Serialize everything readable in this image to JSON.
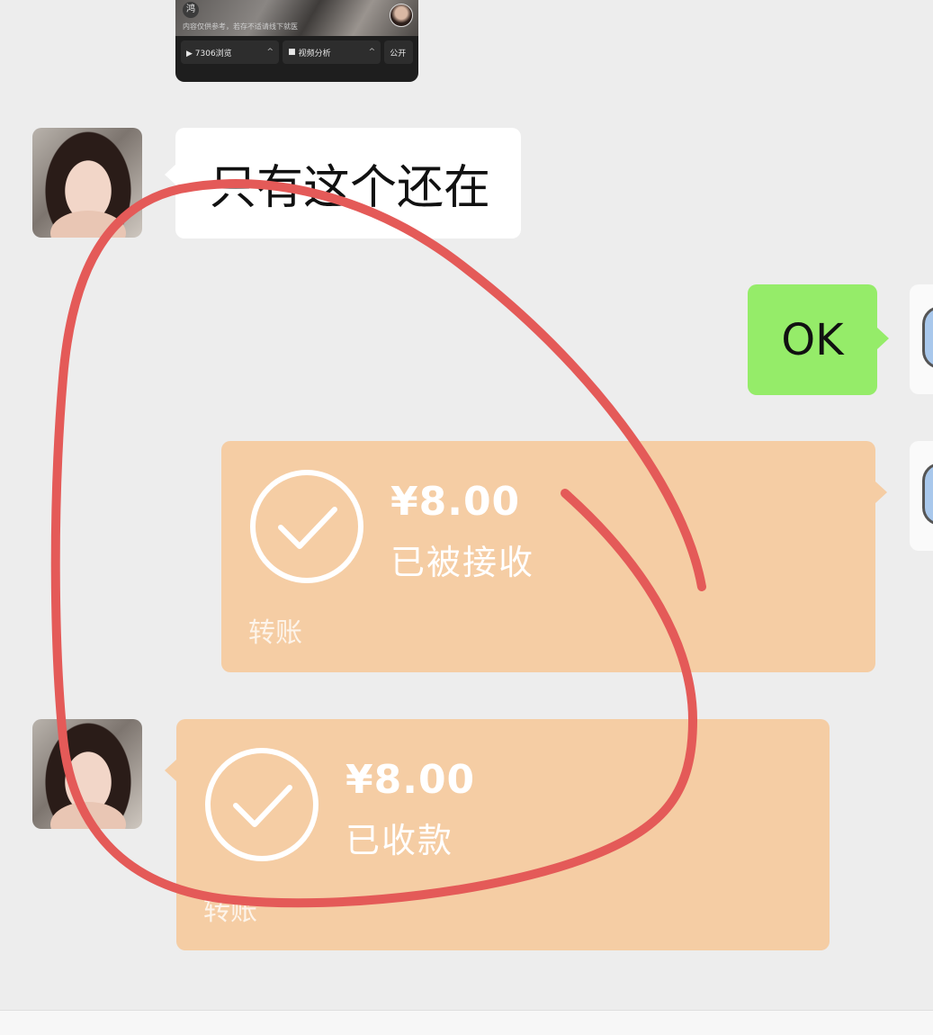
{
  "video_card": {
    "logo_text": "鸿",
    "note": "内容仅供参考，若存不适请线下就医",
    "views_label": "▶ 7306浏览",
    "analysis_label": "视频分析",
    "public_label": "公开",
    "caret": "^"
  },
  "messages": [
    {
      "side": "left",
      "type": "text",
      "text": "只有这个还在"
    },
    {
      "side": "right",
      "type": "text",
      "text": "OK"
    },
    {
      "side": "right",
      "type": "transfer",
      "amount": "¥8.00",
      "status": "已被接收",
      "label": "转账"
    },
    {
      "side": "left",
      "type": "transfer",
      "amount": "¥8.00",
      "status": "已收款",
      "label": "转账"
    }
  ],
  "colors": {
    "background": "#ededed",
    "bubble_white": "#ffffff",
    "bubble_green": "#95ec69",
    "transfer": "#f5cda4",
    "annotation": "#e45a58"
  },
  "icons": {
    "received": "check-circle-icon"
  }
}
